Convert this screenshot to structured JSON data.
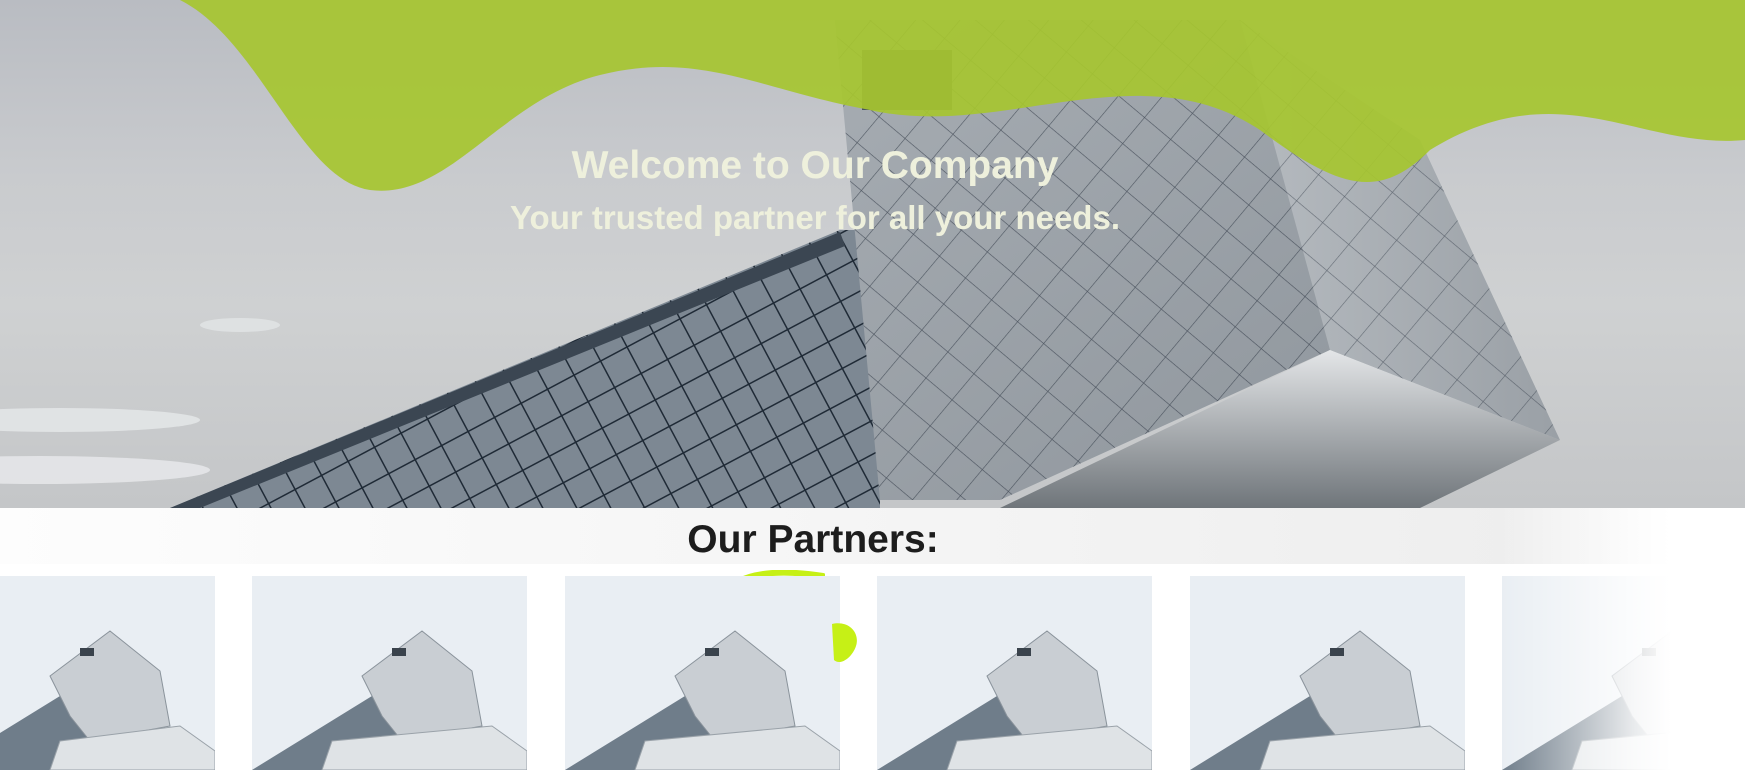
{
  "hero": {
    "title": "Welcome to Our Company",
    "subtitle": "Your trusted partner for all your needs."
  },
  "partners": {
    "heading": "Our Partners:",
    "cards": [
      {
        "image": "building-photo"
      },
      {
        "image": "building-photo"
      },
      {
        "image": "building-photo"
      },
      {
        "image": "building-photo"
      },
      {
        "image": "building-photo"
      },
      {
        "image": "building-photo"
      }
    ]
  },
  "colors": {
    "accent_green": "#a6c530",
    "heading_text": "#1d1d1d",
    "hero_text": "#eef0dc"
  }
}
